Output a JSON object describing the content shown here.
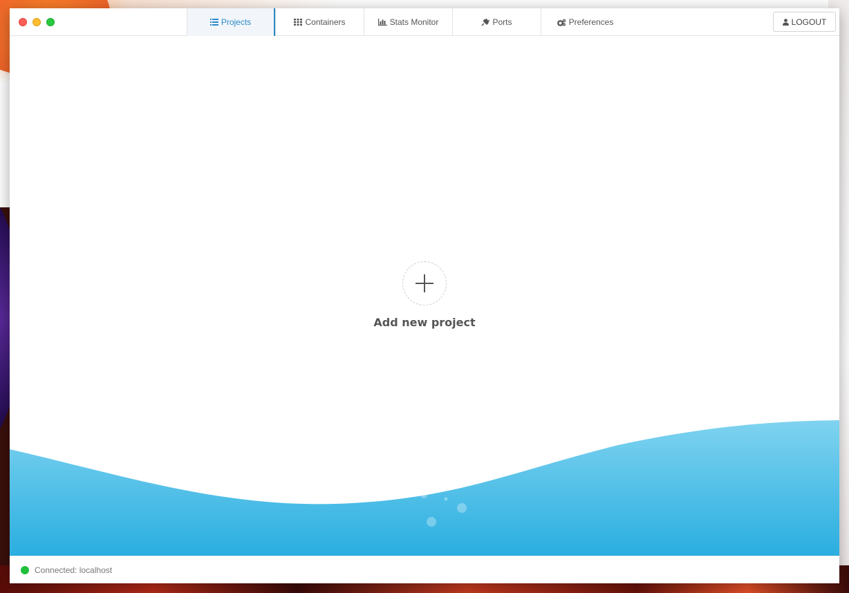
{
  "nav": {
    "tabs": [
      {
        "label": "Projects",
        "icon": "list-icon"
      },
      {
        "label": "Containers",
        "icon": "grid-icon"
      },
      {
        "label": "Stats Monitor",
        "icon": "bar-chart-icon"
      },
      {
        "label": "Ports",
        "icon": "plug-icon"
      },
      {
        "label": "Preferences",
        "icon": "gears-icon"
      }
    ],
    "active_tab": "Projects",
    "logout_label": "LOGOUT"
  },
  "main": {
    "add_project_label": "Add new project"
  },
  "status": {
    "text": "Connected: localhost",
    "connected": true
  },
  "colors": {
    "accent": "#2a88c8",
    "status_connected": "#1fbf3a",
    "wave_top": "#7fd3f0",
    "wave_bottom": "#2aaee0"
  }
}
